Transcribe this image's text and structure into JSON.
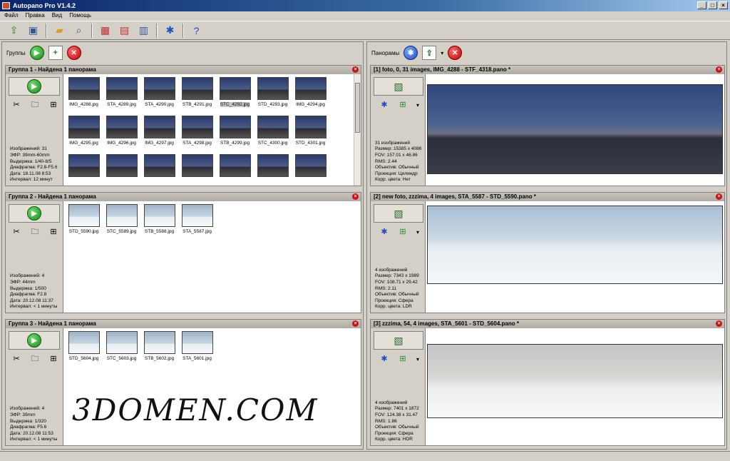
{
  "window": {
    "title": "Autopano Pro V1.4.2",
    "minimize": "_",
    "maximize": "□",
    "close": "×"
  },
  "menu": [
    "Файл",
    "Правка",
    "Вид",
    "Помощь"
  ],
  "left_header": {
    "label": "Группы"
  },
  "right_header": {
    "label": "Панорамы"
  },
  "groups": [
    {
      "title": "Группа 1 - Найдена 1 панорама",
      "info": [
        "Изображений: 31",
        "ЭФР: 39mm-60mm",
        "Выдержка: 1/40-8/5",
        "Диафрагма: F2.8-F5.6",
        "Дата: 18.11.08 8:53",
        "Интервал: 12 минут"
      ],
      "thumbs": [
        "IMG_4288.jpg",
        "STA_4289.jpg",
        "STA_4290.jpg",
        "STB_4291.jpg",
        "STC_4292.jpg",
        "STD_4293.jpg",
        "IMG_4294.jpg",
        "IMG_4295.jpg",
        "IMG_4296.jpg",
        "IMG_4297.jpg",
        "STA_4298.jpg",
        "STB_4299.jpg",
        "STC_4300.jpg",
        "STD_4301.jpg",
        "",
        "",
        "",
        "",
        "",
        "",
        ""
      ]
    },
    {
      "title": "Группа 2 - Найдена 1 панорама",
      "info": [
        "Изображений: 4",
        "ЭФР: 44mm",
        "Выдержка: 1/500",
        "Диафрагма: F2.8",
        "Дата: 20.12.08 11:37",
        "Интервал: < 1 минуты"
      ],
      "thumbs": [
        "STD_5590.jpg",
        "STC_5589.jpg",
        "STB_5588.jpg",
        "STA_5587.jpg"
      ]
    },
    {
      "title": "Группа 3 - Найдена 1 панорама",
      "info": [
        "Изображений: 4",
        "ЭФР: 39mm",
        "Выдержка: 1/320",
        "Диафрагма: F5.6",
        "Дата: 20.12.08 11:53",
        "Интервал: < 1 минуты"
      ],
      "thumbs": [
        "STD_5604.jpg",
        "STC_5603.jpg",
        "STB_5602.jpg",
        "STA_5601.jpg"
      ]
    }
  ],
  "panoramas": [
    {
      "title": "[1] foto, 0, 31 images, IMG_4288 - STF_4318.pano *",
      "info": [
        "31 изображений",
        "Размер: 15385 x 4086",
        "FOV: 157.01 x 46.86",
        "RMS: 2.44",
        "Объектив: Обычный",
        "Проекция: Цилиндр",
        "Корр. цвета: Нет"
      ]
    },
    {
      "title": "[2] new foto, zzzima, 4 images, STA_5587 - STD_5590.pano *",
      "info": [
        "4 изображений",
        "Размер: 7343 x 1989",
        "FOV: 108.71 x 29.42",
        "RMS: 2.11",
        "Объектив: Обычный",
        "Проекция: Сфера",
        "Корр. цвета: LDR"
      ]
    },
    {
      "title": "[3] zzzima, 54, 4 images, STA_5601 - STD_5604.pano *",
      "info": [
        "4 изображений",
        "Размер: 7401 x 1872",
        "FOV: 124.38 x 31.47",
        "RMS: 1.86",
        "Объектив: Обычный",
        "Проекция: Сфера",
        "Корр. цвета: HDR"
      ]
    }
  ],
  "selected_thumb": "STC_4292.jpg",
  "watermark": "3DOMEN.COM",
  "toolbar_icons": [
    "import-icon",
    "save-icon",
    "open-folder-icon",
    "search-icon",
    "grid-icon",
    "list-icon",
    "layout-icon",
    "settings-icon",
    "help-icon"
  ],
  "colors": {
    "title_bar": "#0a246a",
    "go_green": "#1a8a1a",
    "close_red": "#c00000",
    "accent_blue": "#1f4fc4"
  }
}
